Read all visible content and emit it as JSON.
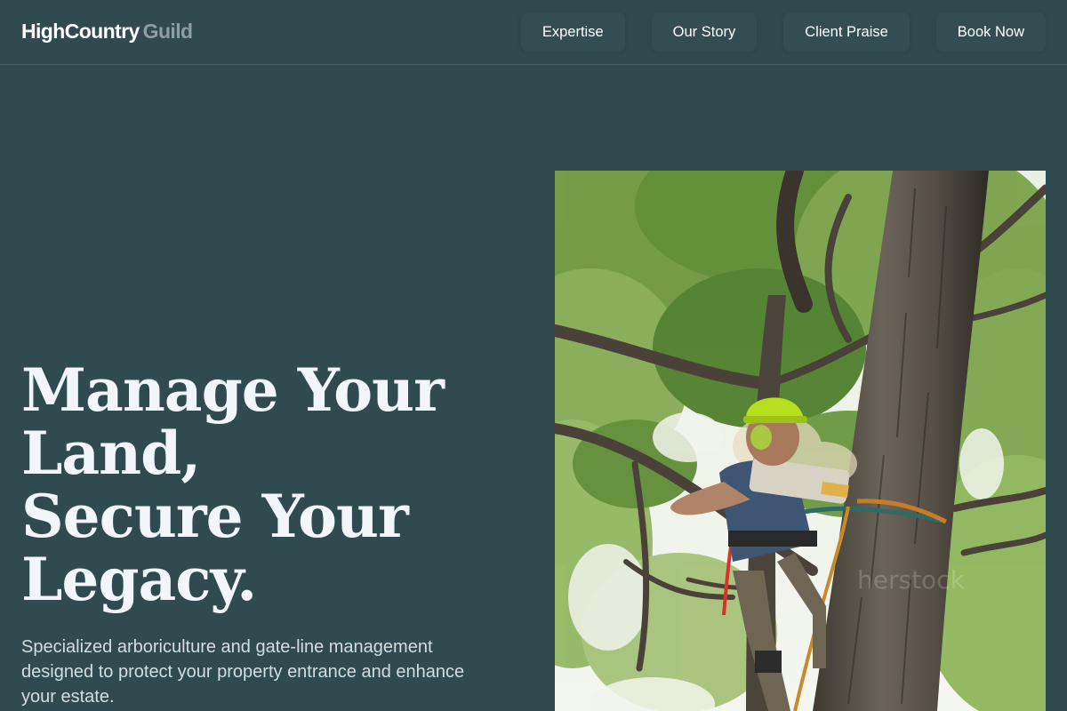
{
  "brand": {
    "name": "HighCountry",
    "accent": "Guild"
  },
  "nav": {
    "items": [
      {
        "label": "Expertise"
      },
      {
        "label": "Our Story"
      },
      {
        "label": "Client Praise"
      },
      {
        "label": "Book Now"
      }
    ]
  },
  "hero": {
    "title_lines": [
      "Manage Your",
      "Land,",
      "Secure Your",
      "Legacy."
    ],
    "subtitle": "Specialized arboriculture and gate-line management designed to protect your property entrance and enhance your estate."
  },
  "colors": {
    "background": "#2f4b4f",
    "brand_accent": "#8e9ea3",
    "helmet": "#b6e01f"
  },
  "photo": {
    "subject": "arborist in helmet cutting branch with chainsaw high in tree"
  }
}
